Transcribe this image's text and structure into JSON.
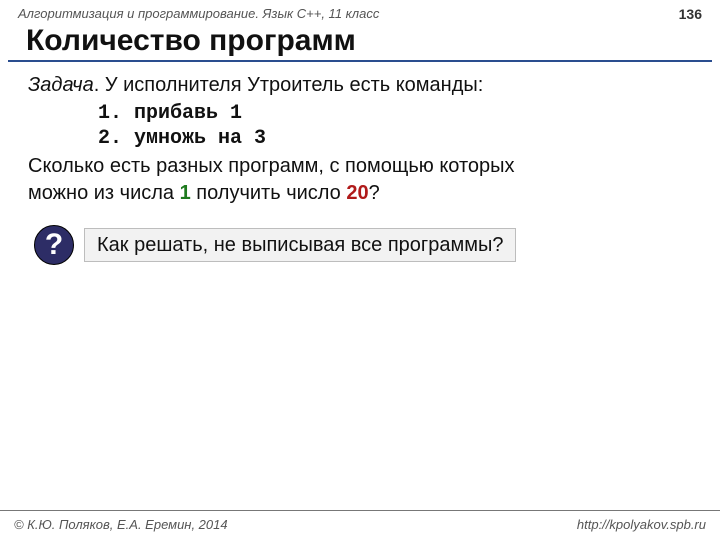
{
  "header": {
    "course": "Алгоритмизация и программирование. Язык C++, 11 класс",
    "page": "136"
  },
  "title": "Количество программ",
  "problem": {
    "label": "Задача",
    "intro_after_label": ". У исполнителя Утроитель есть команды:",
    "cmd1": "1. прибавь 1",
    "cmd2": "2. умножь на 3",
    "q_line1": "Сколько есть разных программ, с помощью которых",
    "q_line2_a": "можно из числа ",
    "q_line2_num1": "1",
    "q_line2_b": " получить число ",
    "q_line2_num2": "20",
    "q_line2_c": "?"
  },
  "hint": {
    "badge": "?",
    "text": "Как решать, не выписывая все программы?"
  },
  "footer": {
    "left": "© К.Ю. Поляков, Е.А. Еремин, 2014",
    "right": "http://kpolyakov.spb.ru"
  }
}
